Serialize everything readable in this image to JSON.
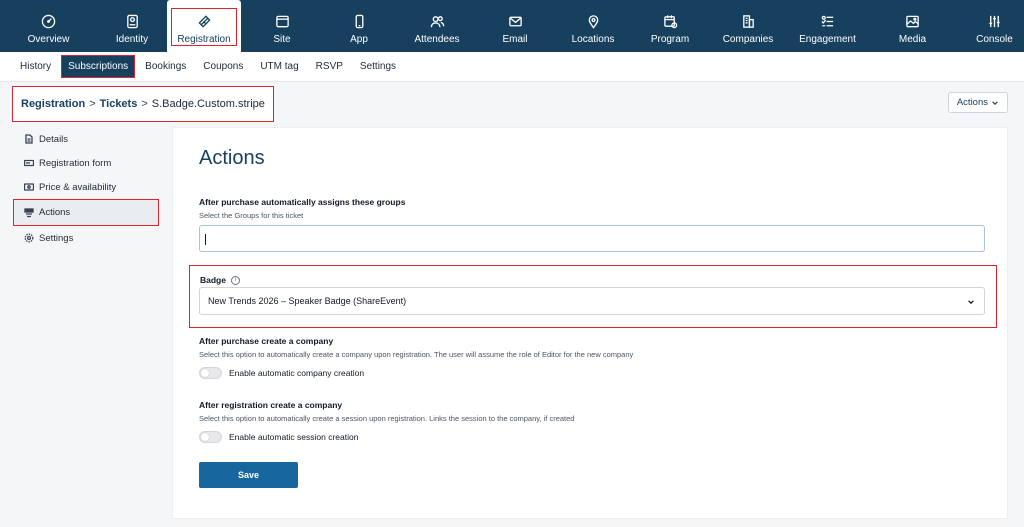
{
  "topnav": {
    "items": [
      {
        "label": "Overview",
        "icon": "gauge-icon"
      },
      {
        "label": "Identity",
        "icon": "id-card-icon"
      },
      {
        "label": "Registration",
        "icon": "ticket-icon"
      },
      {
        "label": "Site",
        "icon": "browser-icon"
      },
      {
        "label": "App",
        "icon": "mobile-icon"
      },
      {
        "label": "Attendees",
        "icon": "users-icon"
      },
      {
        "label": "Email",
        "icon": "mail-icon"
      },
      {
        "label": "Locations",
        "icon": "pin-icon"
      },
      {
        "label": "Program",
        "icon": "calendar-clock-icon"
      },
      {
        "label": "Companies",
        "icon": "building-icon"
      },
      {
        "label": "Engagement",
        "icon": "engagement-icon"
      },
      {
        "label": "Media",
        "icon": "image-icon"
      },
      {
        "label": "Console",
        "icon": "sliders-icon"
      }
    ],
    "active": "Registration"
  },
  "subnav": {
    "items": [
      "History",
      "Subscriptions",
      "Bookings",
      "Coupons",
      "UTM tag",
      "RSVP",
      "Settings"
    ],
    "active": "Subscriptions"
  },
  "breadcrumb": {
    "level1": "Registration",
    "level2": "Tickets",
    "current": "S.Badge.Custom.stripe",
    "separator": ">"
  },
  "actions_button": "Actions",
  "sidebar": {
    "items": [
      {
        "label": "Details",
        "icon": "document-icon"
      },
      {
        "label": "Registration form",
        "icon": "form-icon"
      },
      {
        "label": "Price & availability",
        "icon": "price-icon"
      },
      {
        "label": "Actions",
        "icon": "actions-icon"
      },
      {
        "label": "Settings",
        "icon": "gear-icon"
      }
    ],
    "active": "Actions"
  },
  "main": {
    "title": "Actions",
    "groups": {
      "label": "After purchase automatically assigns these groups",
      "help": "Select the Groups for this ticket",
      "value": ""
    },
    "badge": {
      "label": "Badge",
      "selected": "New Trends 2026 – Speaker Badge (ShareEvent)"
    },
    "company": {
      "label": "After purchase create a company",
      "help": "Select this option to automatically create a company upon registration. The user will assume the role of Editor for the new company",
      "toggle_label": "Enable automatic company creation",
      "enabled": false
    },
    "session": {
      "label": "After registration create a company",
      "help": "Select this option to automatically create a session upon registration. Links the session to the company, if created",
      "toggle_label": "Enable automatic session creation",
      "enabled": false
    },
    "save_label": "Save"
  },
  "colors": {
    "nav_bg": "#17405f",
    "accent": "#17669e",
    "highlight": "#d9252b"
  }
}
